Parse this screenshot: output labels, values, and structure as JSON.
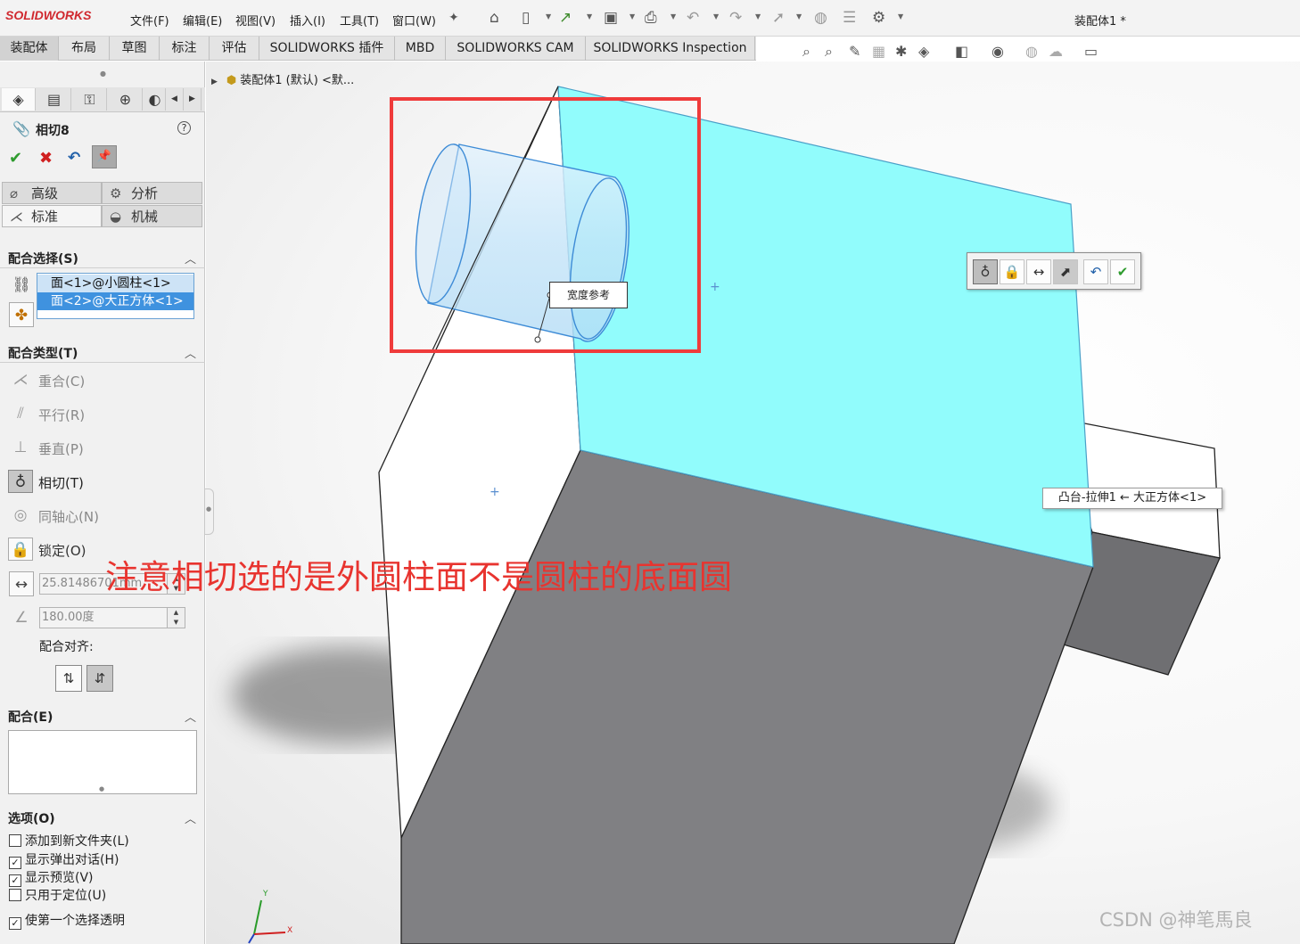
{
  "app": {
    "logo": "SOLIDWORKS",
    "doc_title": "装配体1 *"
  },
  "menu": [
    "文件(F)",
    "编辑(E)",
    "视图(V)",
    "插入(I)",
    "工具(T)",
    "窗口(W)"
  ],
  "command_tabs": [
    "装配体",
    "布局",
    "草图",
    "标注",
    "评估",
    "SOLIDWORKS 插件",
    "MBD",
    "SOLIDWORKS CAM",
    "SOLIDWORKS Inspection"
  ],
  "property_manager": {
    "title": "相切8",
    "tabs": {
      "advanced": "高级",
      "analysis": "分析",
      "standard": "标准",
      "mechanical": "机械"
    },
    "mate_selection": {
      "title": "配合选择(S)",
      "items": [
        "面<1>@小圆柱<1>",
        "面<2>@大正方体<1>"
      ]
    },
    "mate_types": {
      "title": "配合类型(T)",
      "items": [
        {
          "label": "重合(C)",
          "icon": "coincident-icon"
        },
        {
          "label": "平行(R)",
          "icon": "parallel-icon"
        },
        {
          "label": "垂直(P)",
          "icon": "perpendicular-icon"
        },
        {
          "label": "相切(T)",
          "icon": "tangent-icon",
          "selected": true
        },
        {
          "label": "同轴心(N)",
          "icon": "concentric-icon"
        },
        {
          "label": "锁定(O)",
          "icon": "lock-icon"
        }
      ],
      "distance_value": "25.81486701mm",
      "angle_value": "180.00度",
      "alignment_label": "配合对齐:"
    },
    "mates": {
      "title": "配合(E)"
    },
    "options": {
      "title": "选项(O)",
      "items": [
        {
          "label": "添加到新文件夹(L)",
          "checked": false
        },
        {
          "label": "显示弹出对话(H)",
          "checked": true
        },
        {
          "label": "显示预览(V)",
          "checked": true
        },
        {
          "label": "只用于定位(U)",
          "checked": false
        },
        {
          "label": "使第一个选择透明",
          "checked": true
        }
      ]
    }
  },
  "viewport": {
    "tree_node": "装配体1 (默认) <默...",
    "callout": "宽度参考",
    "tooltip": "凸台-拉伸1 ← 大正方体<1>",
    "annotation": "注意相切选的是外圆柱面不是圆柱的底面圆",
    "axis_y": "Y",
    "axis_x": "X"
  },
  "watermark": "CSDN @神笔馬良",
  "colors": {
    "highlight_face": "#91fcfc",
    "annotation": "#e8342f",
    "selection": "#3f92df",
    "block_gray": "#808083"
  }
}
